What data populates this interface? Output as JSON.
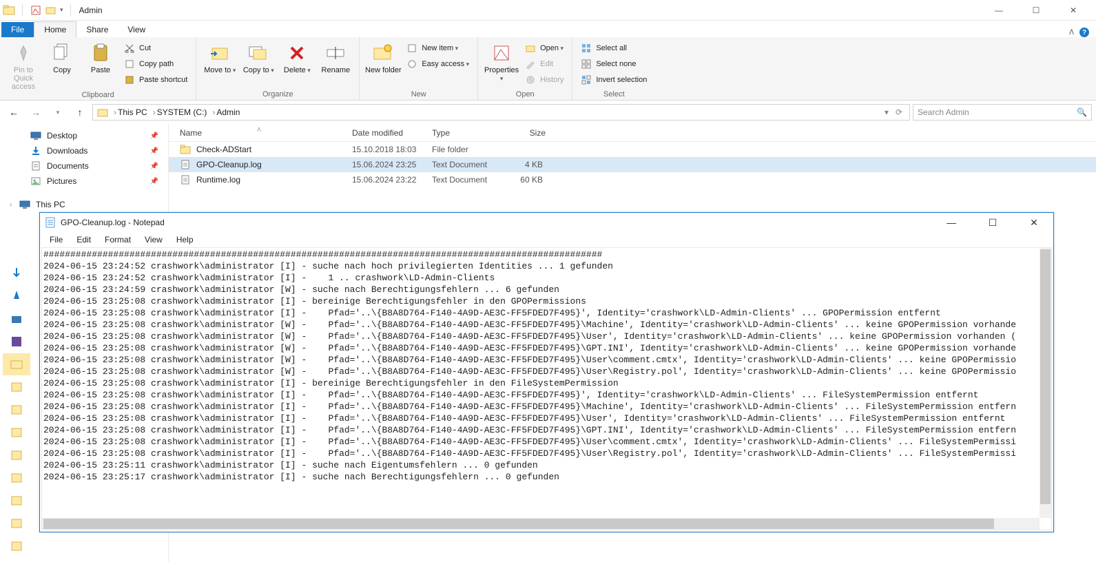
{
  "window_title": "Admin",
  "menutabs": {
    "file": "File",
    "home": "Home",
    "share": "Share",
    "view": "View"
  },
  "ribbon": {
    "clipboard": {
      "caption": "Clipboard",
      "pin": "Pin to Quick access",
      "copy": "Copy",
      "paste": "Paste",
      "cut": "Cut",
      "copy_path": "Copy path",
      "paste_shortcut": "Paste shortcut"
    },
    "organize": {
      "caption": "Organize",
      "move_to": "Move to",
      "copy_to": "Copy to",
      "delete": "Delete",
      "rename": "Rename"
    },
    "new": {
      "caption": "New",
      "new_folder": "New folder",
      "new_item": "New item",
      "easy_access": "Easy access"
    },
    "open_grp": {
      "caption": "Open",
      "properties": "Properties",
      "open": "Open",
      "edit": "Edit",
      "history": "History"
    },
    "select": {
      "caption": "Select",
      "select_all": "Select all",
      "select_none": "Select none",
      "invert": "Invert selection"
    }
  },
  "breadcrumbs": [
    "This PC",
    "SYSTEM (C:)",
    "Admin"
  ],
  "search_placeholder": "Search Admin",
  "nav_items": [
    {
      "label": "Desktop",
      "icon": "desktop",
      "pin": true,
      "sub": true
    },
    {
      "label": "Downloads",
      "icon": "download",
      "pin": true,
      "sub": true
    },
    {
      "label": "Documents",
      "icon": "document",
      "pin": true,
      "sub": true
    },
    {
      "label": "Pictures",
      "icon": "picture",
      "pin": true,
      "sub": true
    }
  ],
  "nav_thispc": "This PC",
  "columns": {
    "name": "Name",
    "date": "Date modified",
    "type": "Type",
    "size": "Size"
  },
  "rows": [
    {
      "name": "Check-ADStart",
      "icon": "folder",
      "date": "15.10.2018 18:03",
      "type": "File folder",
      "size": "",
      "selected": false
    },
    {
      "name": "GPO-Cleanup.log",
      "icon": "file",
      "date": "15.06.2024 23:25",
      "type": "Text Document",
      "size": "4 KB",
      "selected": true
    },
    {
      "name": "Runtime.log",
      "icon": "file",
      "date": "15.06.2024 23:22",
      "type": "Text Document",
      "size": "60 KB",
      "selected": false
    }
  ],
  "notepad": {
    "title": "GPO-Cleanup.log - Notepad",
    "menu": [
      "File",
      "Edit",
      "Format",
      "View",
      "Help"
    ],
    "lines": [
      "########################################################################################################",
      "2024-06-15 23:24:52 crashwork\\administrator [I] - suche nach hoch privilegierten Identities ... 1 gefunden",
      "2024-06-15 23:24:52 crashwork\\administrator [I] -    1 .. crashwork\\LD-Admin-Clients",
      "2024-06-15 23:24:59 crashwork\\administrator [W] - suche nach Berechtigungsfehlern ... 6 gefunden",
      "2024-06-15 23:25:08 crashwork\\administrator [I] - bereinige Berechtigungsfehler in den GPOPermissions",
      "2024-06-15 23:25:08 crashwork\\administrator [I] -    Pfad='..\\{B8A8D764-F140-4A9D-AE3C-FF5FDED7F495}', Identity='crashwork\\LD-Admin-Clients' ... GPOPermission entfernt",
      "2024-06-15 23:25:08 crashwork\\administrator [W] -    Pfad='..\\{B8A8D764-F140-4A9D-AE3C-FF5FDED7F495}\\Machine', Identity='crashwork\\LD-Admin-Clients' ... keine GPOPermission vorhande",
      "2024-06-15 23:25:08 crashwork\\administrator [W] -    Pfad='..\\{B8A8D764-F140-4A9D-AE3C-FF5FDED7F495}\\User', Identity='crashwork\\LD-Admin-Clients' ... keine GPOPermission vorhanden (",
      "2024-06-15 23:25:08 crashwork\\administrator [W] -    Pfad='..\\{B8A8D764-F140-4A9D-AE3C-FF5FDED7F495}\\GPT.INI', Identity='crashwork\\LD-Admin-Clients' ... keine GPOPermission vorhande",
      "2024-06-15 23:25:08 crashwork\\administrator [W] -    Pfad='..\\{B8A8D764-F140-4A9D-AE3C-FF5FDED7F495}\\User\\comment.cmtx', Identity='crashwork\\LD-Admin-Clients' ... keine GPOPermissio",
      "2024-06-15 23:25:08 crashwork\\administrator [W] -    Pfad='..\\{B8A8D764-F140-4A9D-AE3C-FF5FDED7F495}\\User\\Registry.pol', Identity='crashwork\\LD-Admin-Clients' ... keine GPOPermissio",
      "2024-06-15 23:25:08 crashwork\\administrator [I] - bereinige Berechtigungsfehler in den FileSystemPermission",
      "2024-06-15 23:25:08 crashwork\\administrator [I] -    Pfad='..\\{B8A8D764-F140-4A9D-AE3C-FF5FDED7F495}', Identity='crashwork\\LD-Admin-Clients' ... FileSystemPermission entfernt",
      "2024-06-15 23:25:08 crashwork\\administrator [I] -    Pfad='..\\{B8A8D764-F140-4A9D-AE3C-FF5FDED7F495}\\Machine', Identity='crashwork\\LD-Admin-Clients' ... FileSystemPermission entfern",
      "2024-06-15 23:25:08 crashwork\\administrator [I] -    Pfad='..\\{B8A8D764-F140-4A9D-AE3C-FF5FDED7F495}\\User', Identity='crashwork\\LD-Admin-Clients' ... FileSystemPermission entfernt",
      "2024-06-15 23:25:08 crashwork\\administrator [I] -    Pfad='..\\{B8A8D764-F140-4A9D-AE3C-FF5FDED7F495}\\GPT.INI', Identity='crashwork\\LD-Admin-Clients' ... FileSystemPermission entfern",
      "2024-06-15 23:25:08 crashwork\\administrator [I] -    Pfad='..\\{B8A8D764-F140-4A9D-AE3C-FF5FDED7F495}\\User\\comment.cmtx', Identity='crashwork\\LD-Admin-Clients' ... FileSystemPermissi",
      "2024-06-15 23:25:08 crashwork\\administrator [I] -    Pfad='..\\{B8A8D764-F140-4A9D-AE3C-FF5FDED7F495}\\User\\Registry.pol', Identity='crashwork\\LD-Admin-Clients' ... FileSystemPermissi",
      "2024-06-15 23:25:11 crashwork\\administrator [I] - suche nach Eigentumsfehlern ... 0 gefunden",
      "2024-06-15 23:25:17 crashwork\\administrator [I] - suche nach Berechtigungsfehlern ... 0 gefunden"
    ]
  }
}
